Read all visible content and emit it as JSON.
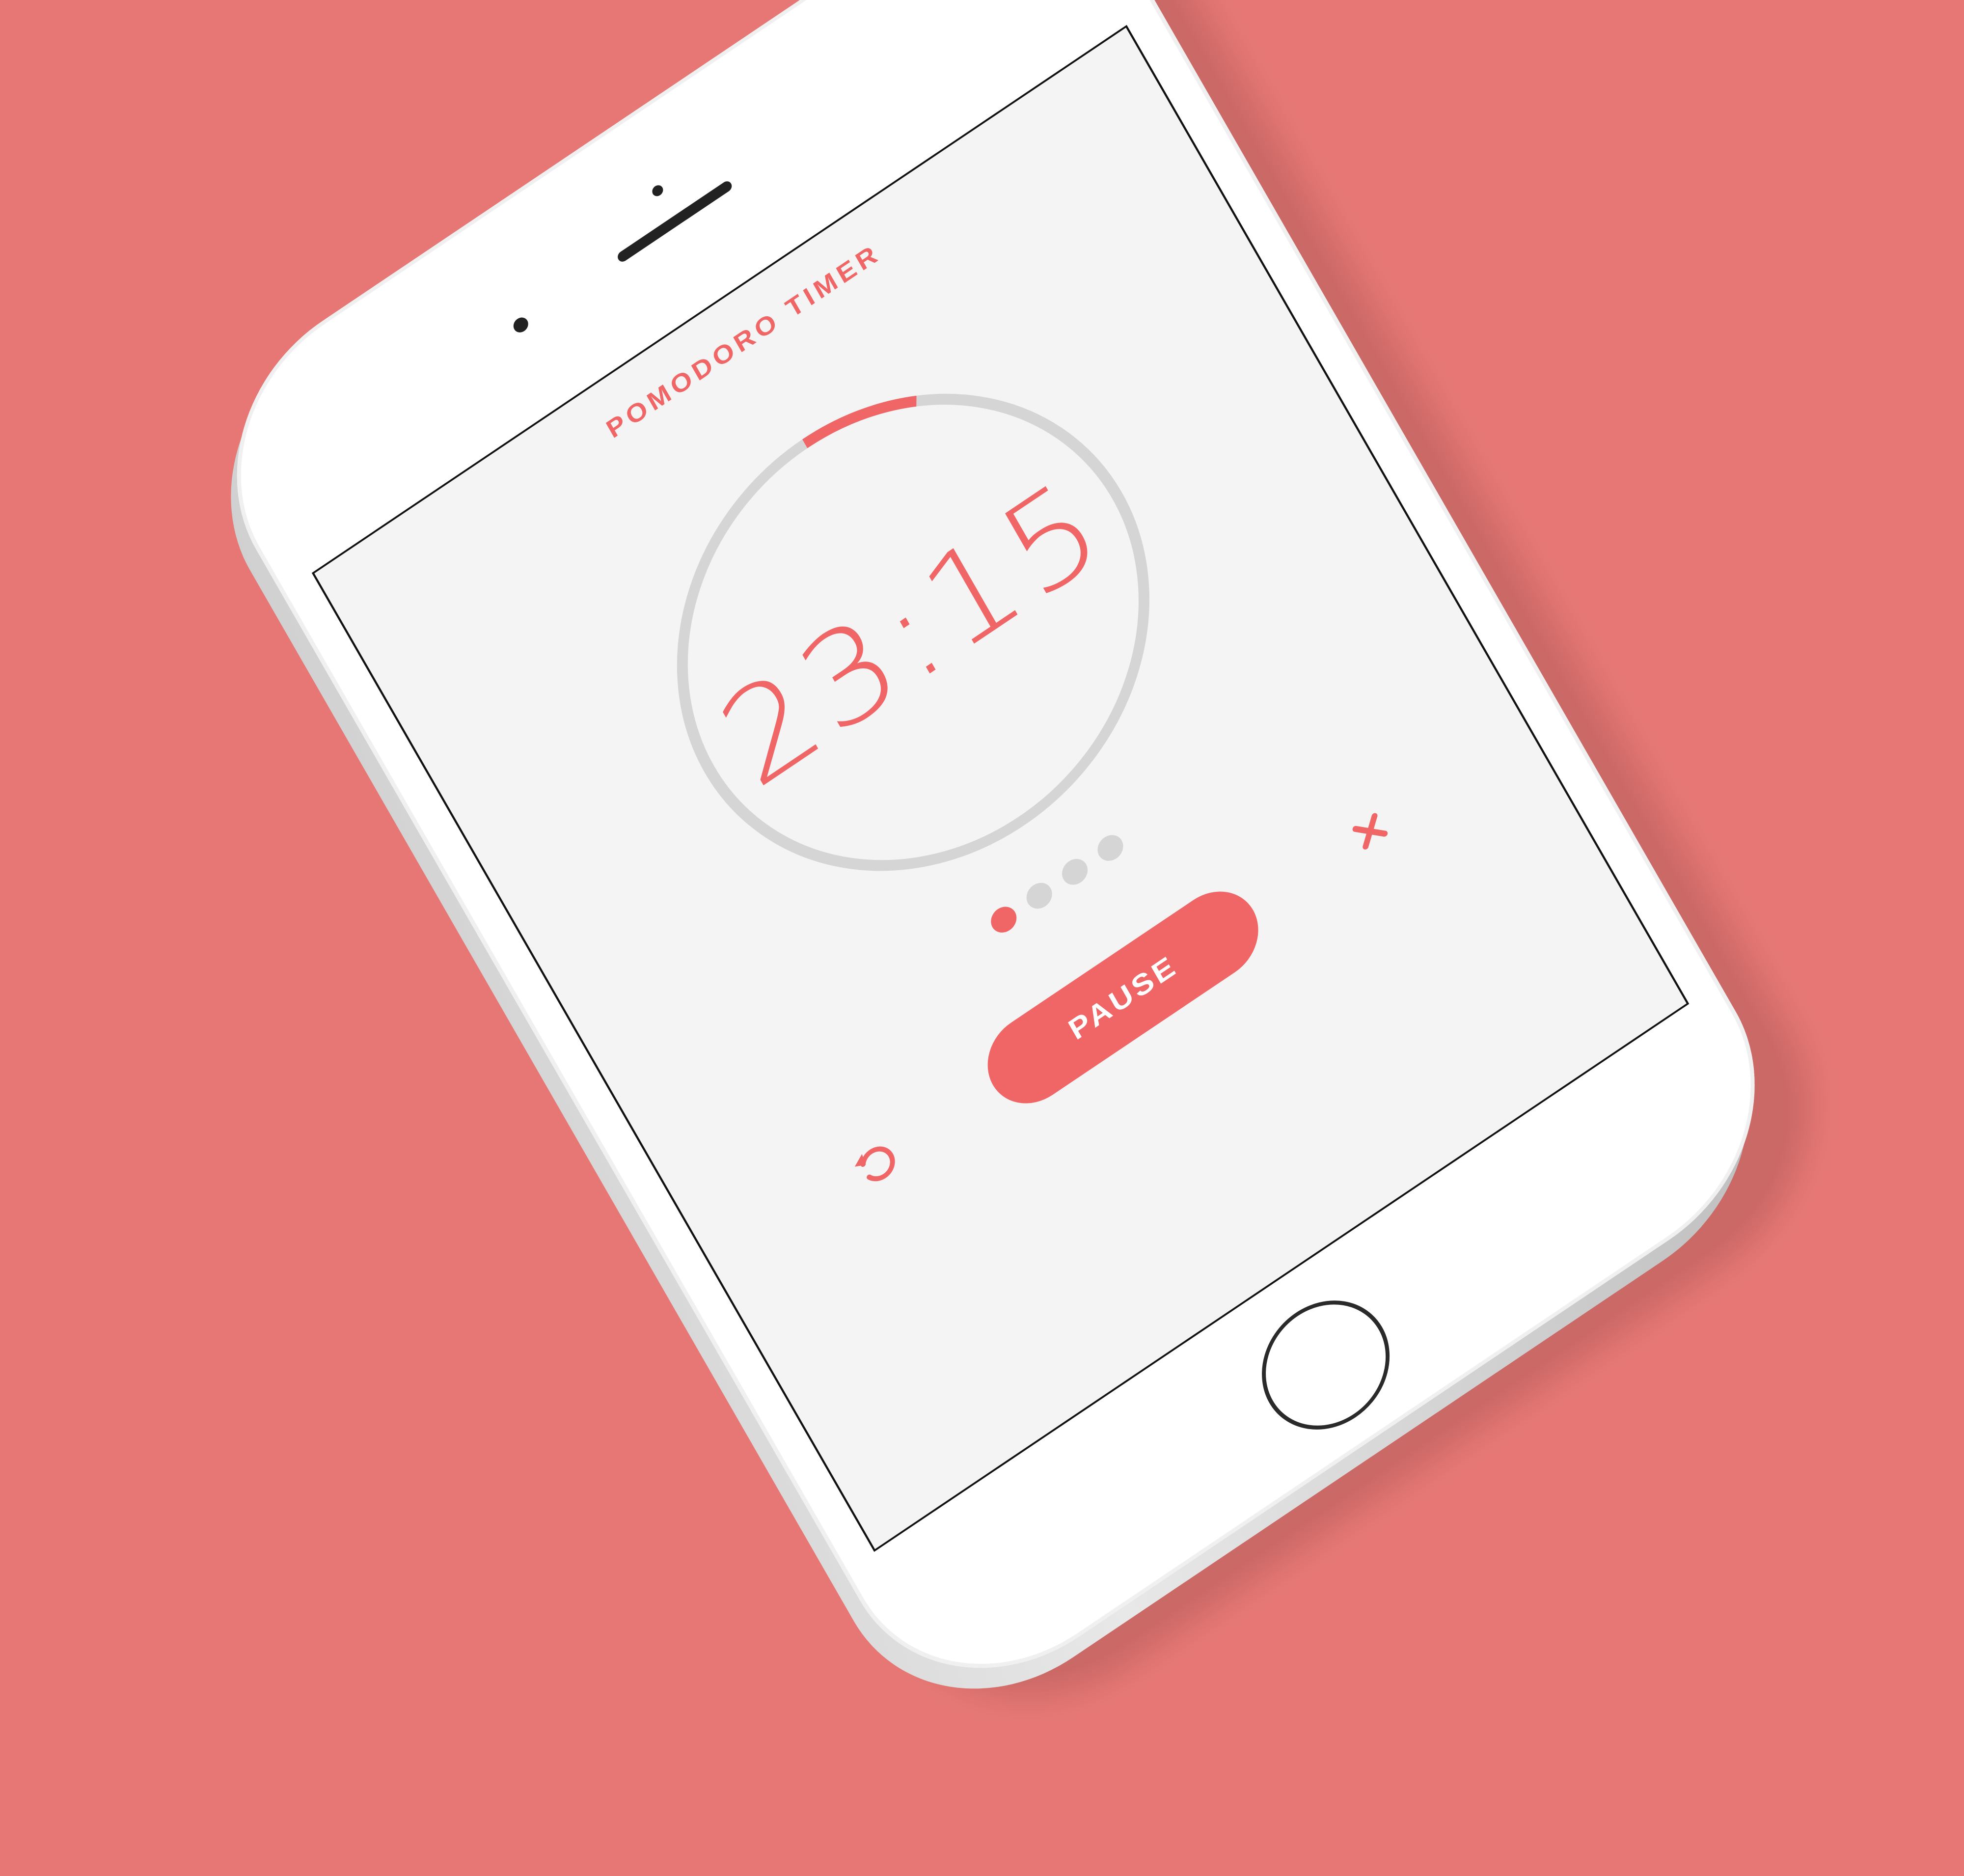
{
  "app": {
    "title": "POMODORO TIMER"
  },
  "timer": {
    "display": "23:15",
    "progress_fraction": 0.08
  },
  "sessions": {
    "total": 4,
    "current": 1
  },
  "controls": {
    "pause_label": "PAUSE",
    "reset_icon": "reset-icon",
    "close_icon": "close-icon"
  },
  "colors": {
    "background": "#e67774",
    "accent": "#f06565",
    "screen": "#f4f4f4",
    "ring_track": "#d5d5d5"
  }
}
